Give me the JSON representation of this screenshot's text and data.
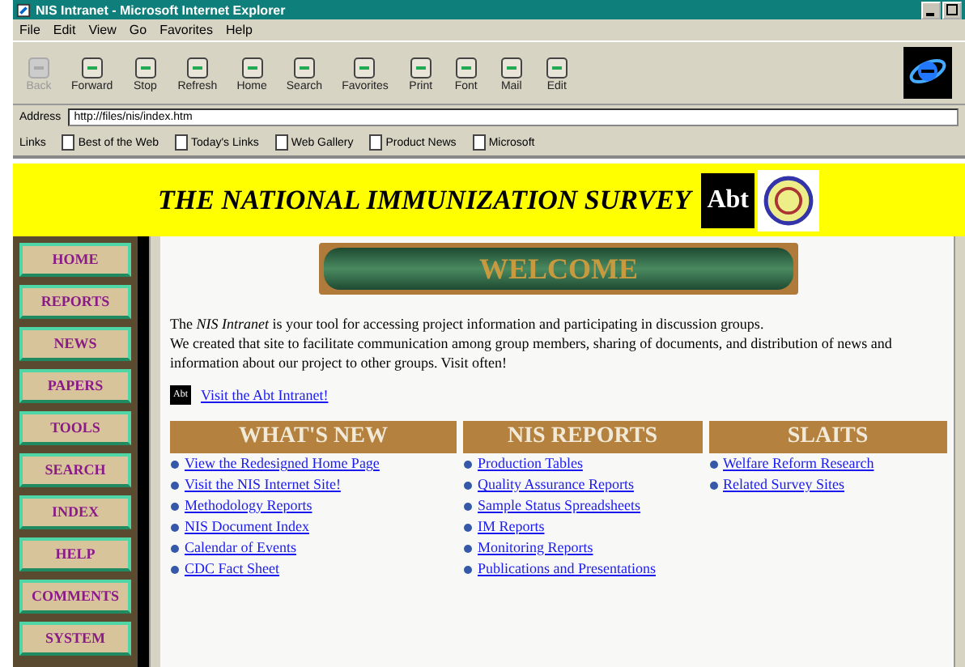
{
  "window": {
    "title": "NIS Intranet - Microsoft Internet Explorer"
  },
  "menu": [
    "File",
    "Edit",
    "View",
    "Go",
    "Favorites",
    "Help"
  ],
  "toolbar": [
    {
      "label": "Back",
      "disabled": true
    },
    {
      "label": "Forward",
      "disabled": false
    },
    {
      "label": "Stop",
      "disabled": false
    },
    {
      "label": "Refresh",
      "disabled": false
    },
    {
      "label": "Home",
      "disabled": false
    },
    {
      "label": "Search",
      "disabled": false
    },
    {
      "label": "Favorites",
      "disabled": false
    },
    {
      "label": "Print",
      "disabled": false
    },
    {
      "label": "Font",
      "disabled": false
    },
    {
      "label": "Mail",
      "disabled": false
    },
    {
      "label": "Edit",
      "disabled": false
    }
  ],
  "address": {
    "label": "Address",
    "value": "http://files/nis/index.htm"
  },
  "links": {
    "label": "Links",
    "items": [
      "Best of the Web",
      "Today's Links",
      "Web Gallery",
      "Product News",
      "Microsoft"
    ]
  },
  "header": {
    "title": "THE NATIONAL IMMUNIZATION SURVEY",
    "logo": "Abt"
  },
  "nav": [
    "HOME",
    "REPORTS",
    "NEWS",
    "PAPERS",
    "TOOLS",
    "SEARCH",
    "INDEX",
    "HELP",
    "COMMENTS",
    "SYSTEM"
  ],
  "welcome": "WELCOME",
  "intro": [
    "The *NIS Intranet* is your tool for accessing project information and participating in discussion groups.",
    "We created that site to facilitate communication among group members, sharing of documents, and distribution of news and information about our project to other groups.  Visit often!"
  ],
  "abt_link": {
    "badge": "Abt",
    "text": "Visit the Abt Intranet!"
  },
  "sections": [
    {
      "title": "WHAT'S NEW",
      "links": [
        "View the Redesigned Home Page",
        "Visit the NIS Internet Site!",
        "Methodology Reports",
        "NIS Document Index",
        "Calendar of Events",
        "CDC Fact Sheet"
      ]
    },
    {
      "title": "NIS REPORTS",
      "links": [
        "Production Tables",
        "Quality Assurance Reports",
        "Sample Status Spreadsheets",
        "IM Reports",
        "Monitoring Reports",
        "Publications and Presentations"
      ]
    },
    {
      "title": "SLAITS",
      "links": [
        "Welfare Reform Research",
        "Related Survey Sites"
      ]
    }
  ]
}
